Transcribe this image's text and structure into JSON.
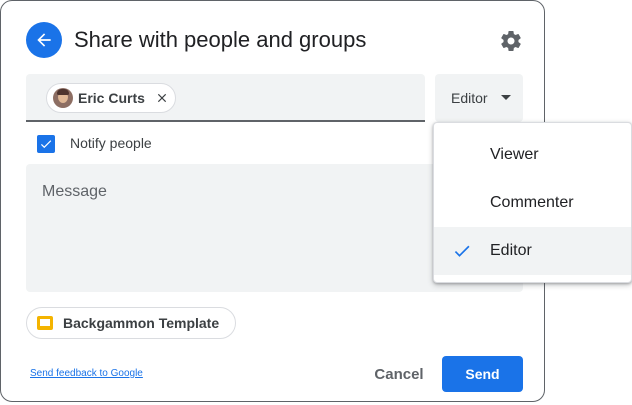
{
  "dialog": {
    "title": "Share with people and groups",
    "back_icon": "arrow-back-icon",
    "settings_icon": "gear-icon"
  },
  "recipients": {
    "chips": [
      {
        "name": "Eric Curts",
        "avatar": "avatar-photo",
        "remove_icon": "close-icon"
      }
    ]
  },
  "role": {
    "selected": "Editor",
    "caret_icon": "caret-down-icon",
    "options": [
      {
        "label": "Viewer",
        "selected": false
      },
      {
        "label": "Commenter",
        "selected": false
      },
      {
        "label": "Editor",
        "selected": true
      }
    ],
    "check_icon": "check-icon"
  },
  "notify": {
    "label": "Notify people",
    "checked": true
  },
  "message": {
    "placeholder": "Message"
  },
  "attachment": {
    "name": "Backgammon Template",
    "icon": "slides-icon",
    "icon_color": "#f4b400"
  },
  "footer": {
    "feedback_link": "Send feedback to Google",
    "cancel_label": "Cancel",
    "send_label": "Send"
  },
  "colors": {
    "accent": "#1a73e8",
    "field_bg": "#f1f3f4"
  }
}
